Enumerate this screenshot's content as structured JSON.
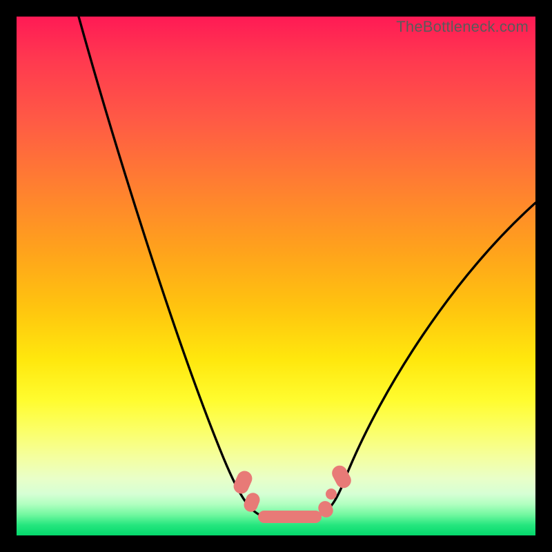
{
  "watermark": "TheBottleneck.com",
  "colors": {
    "frame_bg": "#000000",
    "curve_stroke": "#000000",
    "blob_fill": "#e87a77"
  },
  "chart_data": {
    "type": "line",
    "title": "",
    "xlabel": "",
    "ylabel": "",
    "xlim": [
      0,
      100
    ],
    "ylim": [
      0,
      100
    ],
    "grid": false,
    "legend": false,
    "note": "Values estimated from pixel positions; y represents height measured from bottom (green=0) to top (red=100).",
    "series": [
      {
        "name": "left-branch",
        "x": [
          12,
          15,
          18,
          21,
          24,
          27,
          30,
          33,
          36,
          39,
          42,
          44,
          46,
          48
        ],
        "y": [
          100,
          92,
          84,
          75,
          66,
          57,
          48,
          40,
          31,
          23,
          14,
          9,
          6,
          4
        ]
      },
      {
        "name": "valley-floor",
        "x": [
          48,
          50,
          52,
          54,
          56,
          58,
          60
        ],
        "y": [
          4,
          3.5,
          3.2,
          3.0,
          3.2,
          3.8,
          5
        ]
      },
      {
        "name": "right-branch",
        "x": [
          60,
          62,
          65,
          68,
          72,
          76,
          80,
          84,
          88,
          92,
          96,
          100
        ],
        "y": [
          5,
          8,
          14,
          21,
          29,
          37,
          44,
          50,
          55,
          59,
          62,
          64
        ]
      }
    ],
    "annotations": [
      {
        "name": "blob-left",
        "x_range": [
          43,
          46
        ],
        "y_range": [
          4,
          12
        ]
      },
      {
        "name": "blob-bottom",
        "x_range": [
          46,
          58.5
        ],
        "y_range": [
          2.5,
          5
        ]
      },
      {
        "name": "blob-right-low",
        "x_range": [
          58,
          61
        ],
        "y_range": [
          4,
          8
        ]
      },
      {
        "name": "blob-right-high",
        "x_range": [
          61,
          64
        ],
        "y_range": [
          9,
          15
        ]
      }
    ],
    "background_gradient": {
      "direction": "vertical",
      "stops": [
        {
          "pos": 0.0,
          "color": "#ff1a55"
        },
        {
          "pos": 0.45,
          "color": "#ffa21c"
        },
        {
          "pos": 0.74,
          "color": "#fffc2f"
        },
        {
          "pos": 0.92,
          "color": "#d6ffd4"
        },
        {
          "pos": 1.0,
          "color": "#04d86c"
        }
      ]
    }
  }
}
